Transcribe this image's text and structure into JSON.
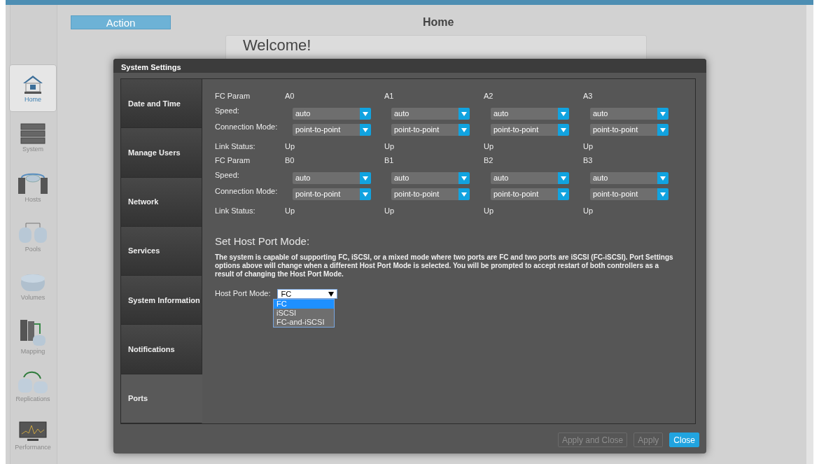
{
  "action_button": "Action",
  "page_title": "Home",
  "welcome": "Welcome!",
  "nav": [
    {
      "label": "Home",
      "selected": true
    },
    {
      "label": "System",
      "selected": false
    },
    {
      "label": "Hosts",
      "selected": false
    },
    {
      "label": "Pools",
      "selected": false
    },
    {
      "label": "Volumes",
      "selected": false
    },
    {
      "label": "Mapping",
      "selected": false
    },
    {
      "label": "Replications",
      "selected": false
    },
    {
      "label": "Performance",
      "selected": false
    }
  ],
  "dialog": {
    "title": "System Settings",
    "tabs": [
      {
        "label": "Date and Time",
        "selected": false
      },
      {
        "label": "Manage Users",
        "selected": false
      },
      {
        "label": "Network",
        "selected": false
      },
      {
        "label": "Services",
        "selected": false
      },
      {
        "label": "System Information",
        "selected": false
      },
      {
        "label": "Notifications",
        "selected": false
      },
      {
        "label": "Ports",
        "selected": true
      }
    ],
    "port_groups": [
      {
        "label": "FC Param",
        "ports": [
          "A0",
          "A1",
          "A2",
          "A3"
        ],
        "rows": [
          {
            "kind": "select",
            "label": "Speed:",
            "values": [
              "auto",
              "auto",
              "auto",
              "auto"
            ]
          },
          {
            "kind": "select",
            "label": "Connection Mode:",
            "values": [
              "point-to-point",
              "point-to-point",
              "point-to-point",
              "point-to-point"
            ]
          },
          {
            "kind": "text",
            "label": "Link Status:",
            "values": [
              "Up",
              "Up",
              "Up",
              "Up"
            ]
          }
        ]
      },
      {
        "label": "FC Param",
        "ports": [
          "B0",
          "B1",
          "B2",
          "B3"
        ],
        "rows": [
          {
            "kind": "select",
            "label": "Speed:",
            "values": [
              "auto",
              "auto",
              "auto",
              "auto"
            ]
          },
          {
            "kind": "select",
            "label": "Connection Mode:",
            "values": [
              "point-to-point",
              "point-to-point",
              "point-to-point",
              "point-to-point"
            ]
          },
          {
            "kind": "text",
            "label": "Link Status:",
            "values": [
              "Up",
              "Up",
              "Up",
              "Up"
            ]
          }
        ]
      }
    ],
    "host_port_mode": {
      "heading": "Set Host Port Mode:",
      "description": "The system is capable of supporting FC, iSCSI, or a mixed mode where two ports are FC and two ports are iSCSI (FC-iSCSI). Port Settings options above will change when a different Host Port Mode is selected. You will be prompted to accept restart of both controllers as a result of changing the Host Port Mode.",
      "label": "Host Port Mode:",
      "value": "FC",
      "expanded": true,
      "options": [
        {
          "label": "FC",
          "selected": true
        },
        {
          "label": "iSCSI",
          "selected": false
        },
        {
          "label": "FC-and-iSCSI",
          "selected": false
        }
      ]
    },
    "buttons": [
      {
        "label": "Apply and Close",
        "disabled": true
      },
      {
        "label": "Apply",
        "disabled": true
      },
      {
        "label": "Close",
        "disabled": false
      }
    ]
  }
}
